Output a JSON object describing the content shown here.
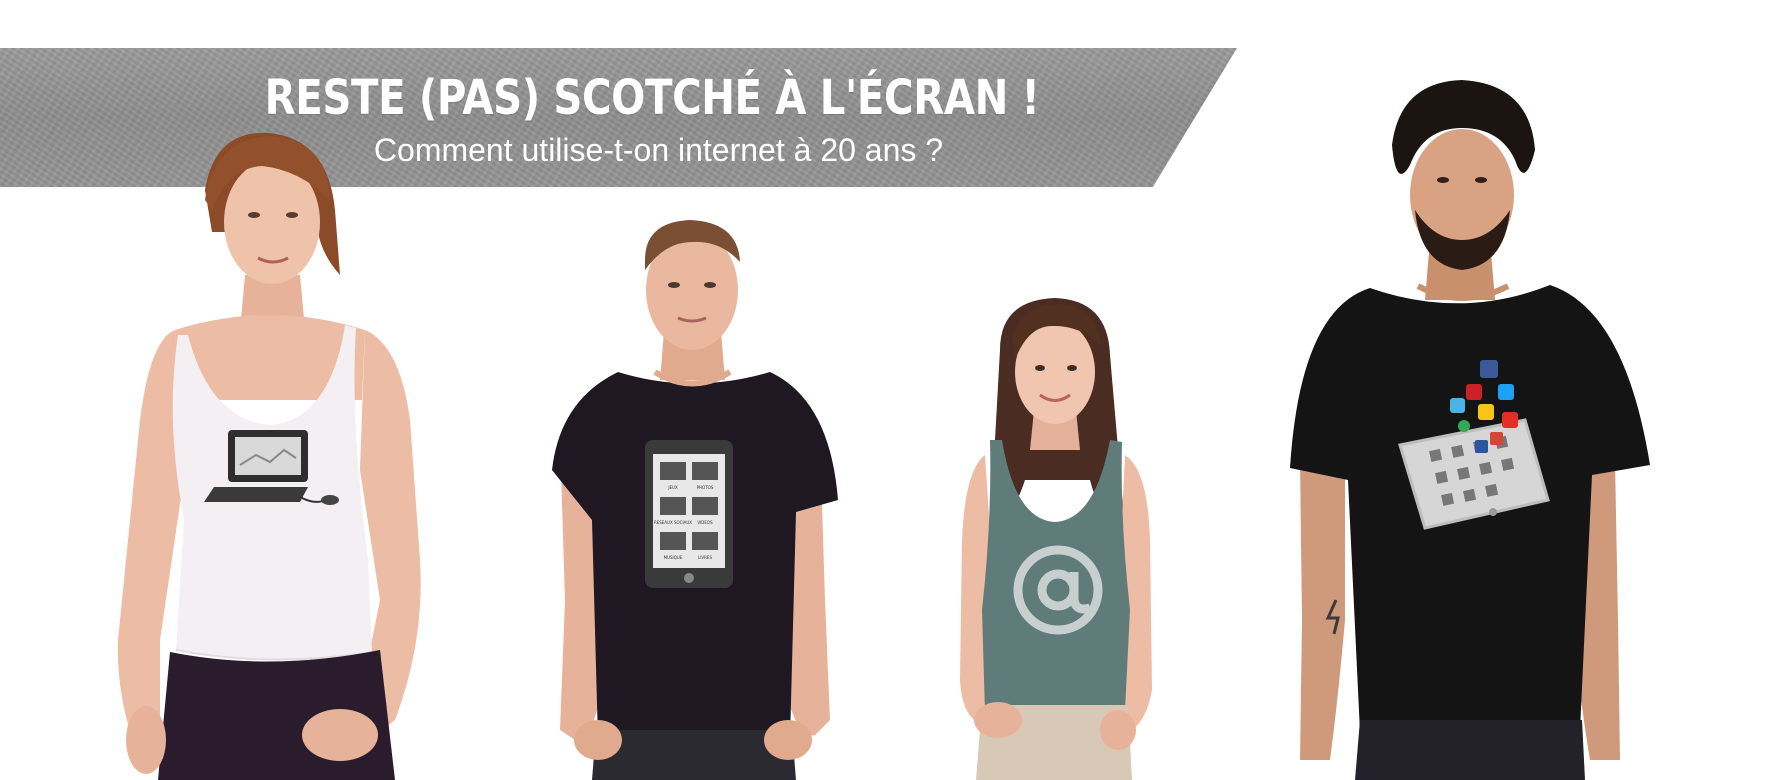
{
  "banner": {
    "title": "RESTE (PAS) SCOTCHÉ À L'ÉCRAN !",
    "subtitle": "Comment utilise-t-on internet à 20 ans ?",
    "color": "#939393"
  },
  "people": [
    {
      "name": "person-woman-white-tank",
      "shirt_graphic": "laptop-icon",
      "shirt_color": "#f3eef1"
    },
    {
      "name": "person-man-dark-tshirt",
      "shirt_graphic": "smartphone-icon",
      "shirt_color": "#1f1722"
    },
    {
      "name": "person-woman-teal-tank",
      "shirt_graphic": "at-sign-icon",
      "shirt_color": "#5f7c7b"
    },
    {
      "name": "person-man-black-tshirt",
      "shirt_graphic": "tablet-social-apps-icon",
      "shirt_color": "#141414"
    }
  ],
  "phone_app_labels": [
    "JEUX",
    "PHOTOS",
    "RESEAUX SOCIAUX",
    "VIDEOS",
    "MUSIQUE",
    "LIVRES"
  ],
  "colors": {
    "skin": "#e9b9a0",
    "dark_pants": "#2a1c2c",
    "beige_pants": "#d8c8b6"
  }
}
